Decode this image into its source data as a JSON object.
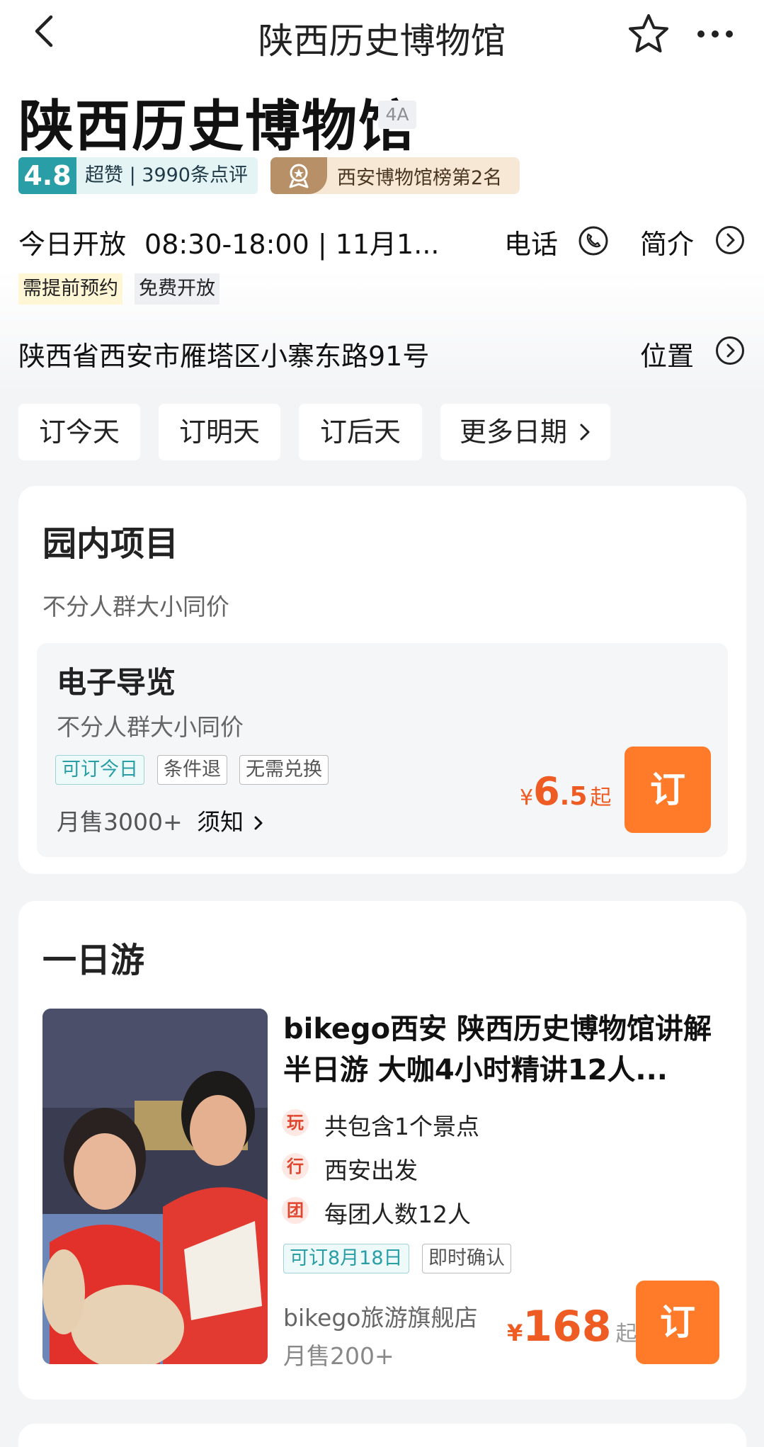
{
  "nav": {
    "title": "陕西历史博物馆",
    "back_icon": "chevron-left-icon",
    "favorite_icon": "star-outline-icon",
    "more_icon": "more-dots-icon"
  },
  "header": {
    "name": "陕西历史博物馆",
    "grade": "4A",
    "score": "4.8",
    "score_text": "超赞 | 3990条点评",
    "rank_text": "西安博物馆榜第2名",
    "open_status": "今日开放",
    "open_time": "08:30-18:00 | 11月1...",
    "phone_label": "电话",
    "intro_label": "简介",
    "tags": [
      "需提前预约",
      "免费开放"
    ],
    "address": "陕西省西安市雁塔区小寨东路91号",
    "location_label": "位置"
  },
  "date_buttons": [
    "订今天",
    "订明天",
    "订后天",
    "更多日期"
  ],
  "colors": {
    "accent_orange": "#ff7a29",
    "price_orange": "#ee5b23",
    "teal": "#2a9ea6"
  },
  "park_items": {
    "title": "园内项目",
    "subtitle": "不分人群大小同价",
    "item": {
      "name": "电子导览",
      "desc": "不分人群大小同价",
      "chips": [
        "可订今日",
        "条件退",
        "无需兑换"
      ],
      "sales": "月售3000+",
      "notice": "须知",
      "currency": "¥",
      "price_int": "6",
      "price_dec": ".5",
      "price_suffix": "起",
      "order_label": "订"
    }
  },
  "day_tour": {
    "title": "一日游",
    "item": {
      "name": "bikego西安 陕西历史博物馆讲解半日游 大咖4小时精讲12人...",
      "features": [
        {
          "icon": "玩",
          "text": "共包含1个景点"
        },
        {
          "icon": "行",
          "text": "西安出发"
        },
        {
          "icon": "团",
          "text": "每团人数12人"
        }
      ],
      "chips": [
        "可订8月18日",
        "即时确认"
      ],
      "shop": "bikego旅游旗舰店",
      "sales": "月售200+",
      "currency": "¥",
      "price": "168",
      "price_suffix": "起",
      "order_label": "订"
    }
  }
}
